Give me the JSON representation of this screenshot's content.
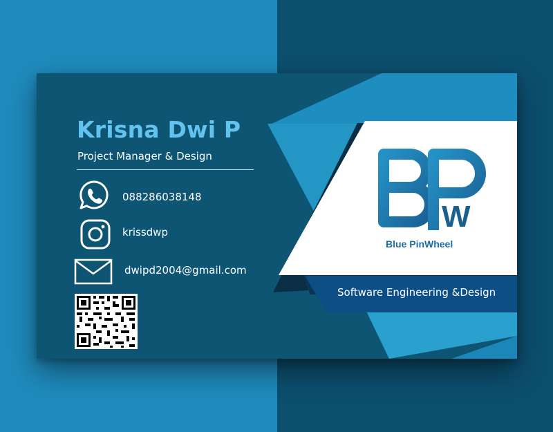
{
  "card": {
    "name": "Krisna Dwi P",
    "title": "Project Manager & Design",
    "contacts": [
      {
        "icon": "whatsapp-icon",
        "value": "088286038148"
      },
      {
        "icon": "instagram-icon",
        "value": "krissdwp"
      },
      {
        "icon": "mail-icon",
        "value": "dwipd2004@gmail.com"
      }
    ],
    "qr_code": "qr-code"
  },
  "brand": {
    "logo_letters": "BPW",
    "logo_w": "W",
    "name": "Blue PinWheel",
    "tagline": "Software Engineering &Design"
  },
  "colors": {
    "background_light": "#1f8bbd",
    "background_dark": "#0c4f6f",
    "card": "#0e5473",
    "accent": "#61c3ee",
    "panel_blue": "#2093c3",
    "ribbon": "#0d4e84",
    "logo_blue": "#1c6ea3"
  }
}
